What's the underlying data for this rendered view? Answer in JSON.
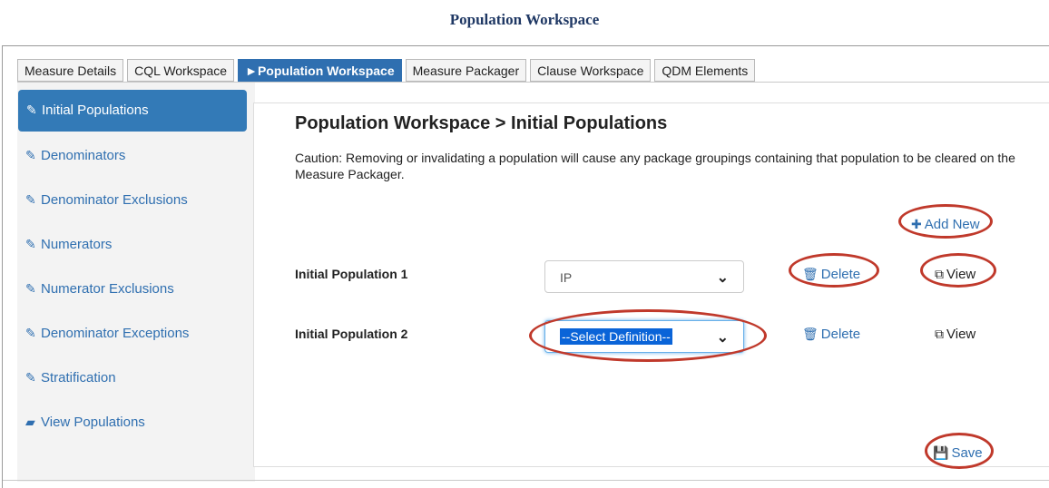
{
  "page_title": "Population Workspace",
  "tabs": [
    {
      "label": "Measure Details",
      "active": false
    },
    {
      "label": "CQL Workspace",
      "active": false
    },
    {
      "label": "►Population Workspace",
      "active": true
    },
    {
      "label": "Measure Packager",
      "active": false
    },
    {
      "label": "Clause Workspace",
      "active": false
    },
    {
      "label": "QDM Elements",
      "active": false
    }
  ],
  "sidebar": {
    "items": [
      {
        "label": "Initial Populations",
        "icon": "pencil-icon",
        "active": true
      },
      {
        "label": "Denominators",
        "icon": "pencil-icon"
      },
      {
        "label": "Denominator Exclusions",
        "icon": "pencil-icon"
      },
      {
        "label": "Numerators",
        "icon": "pencil-icon"
      },
      {
        "label": "Numerator Exclusions",
        "icon": "pencil-icon"
      },
      {
        "label": "Denominator Exceptions",
        "icon": "pencil-icon"
      },
      {
        "label": "Stratification",
        "icon": "pencil-icon"
      },
      {
        "label": "View Populations",
        "icon": "book-icon"
      }
    ]
  },
  "main": {
    "heading": "Population Workspace > Initial Populations",
    "caution": "Caution: Removing or invalidating a population will cause any package groupings containing that population to be cleared on the Measure Packager.",
    "add_new_label": "Add New",
    "populations": [
      {
        "label": "Initial Population 1",
        "selected": "IP",
        "delete_label": "Delete",
        "view_label": "View"
      },
      {
        "label": "Initial Population 2",
        "selected": "--Select Definition--",
        "delete_label": "Delete",
        "view_label": "View"
      }
    ],
    "save_label": "Save"
  },
  "colors": {
    "accent": "#2f6fb0",
    "active_tab": "#2f6fb0",
    "annotation": "#c0392b",
    "title": "#1f3864"
  }
}
